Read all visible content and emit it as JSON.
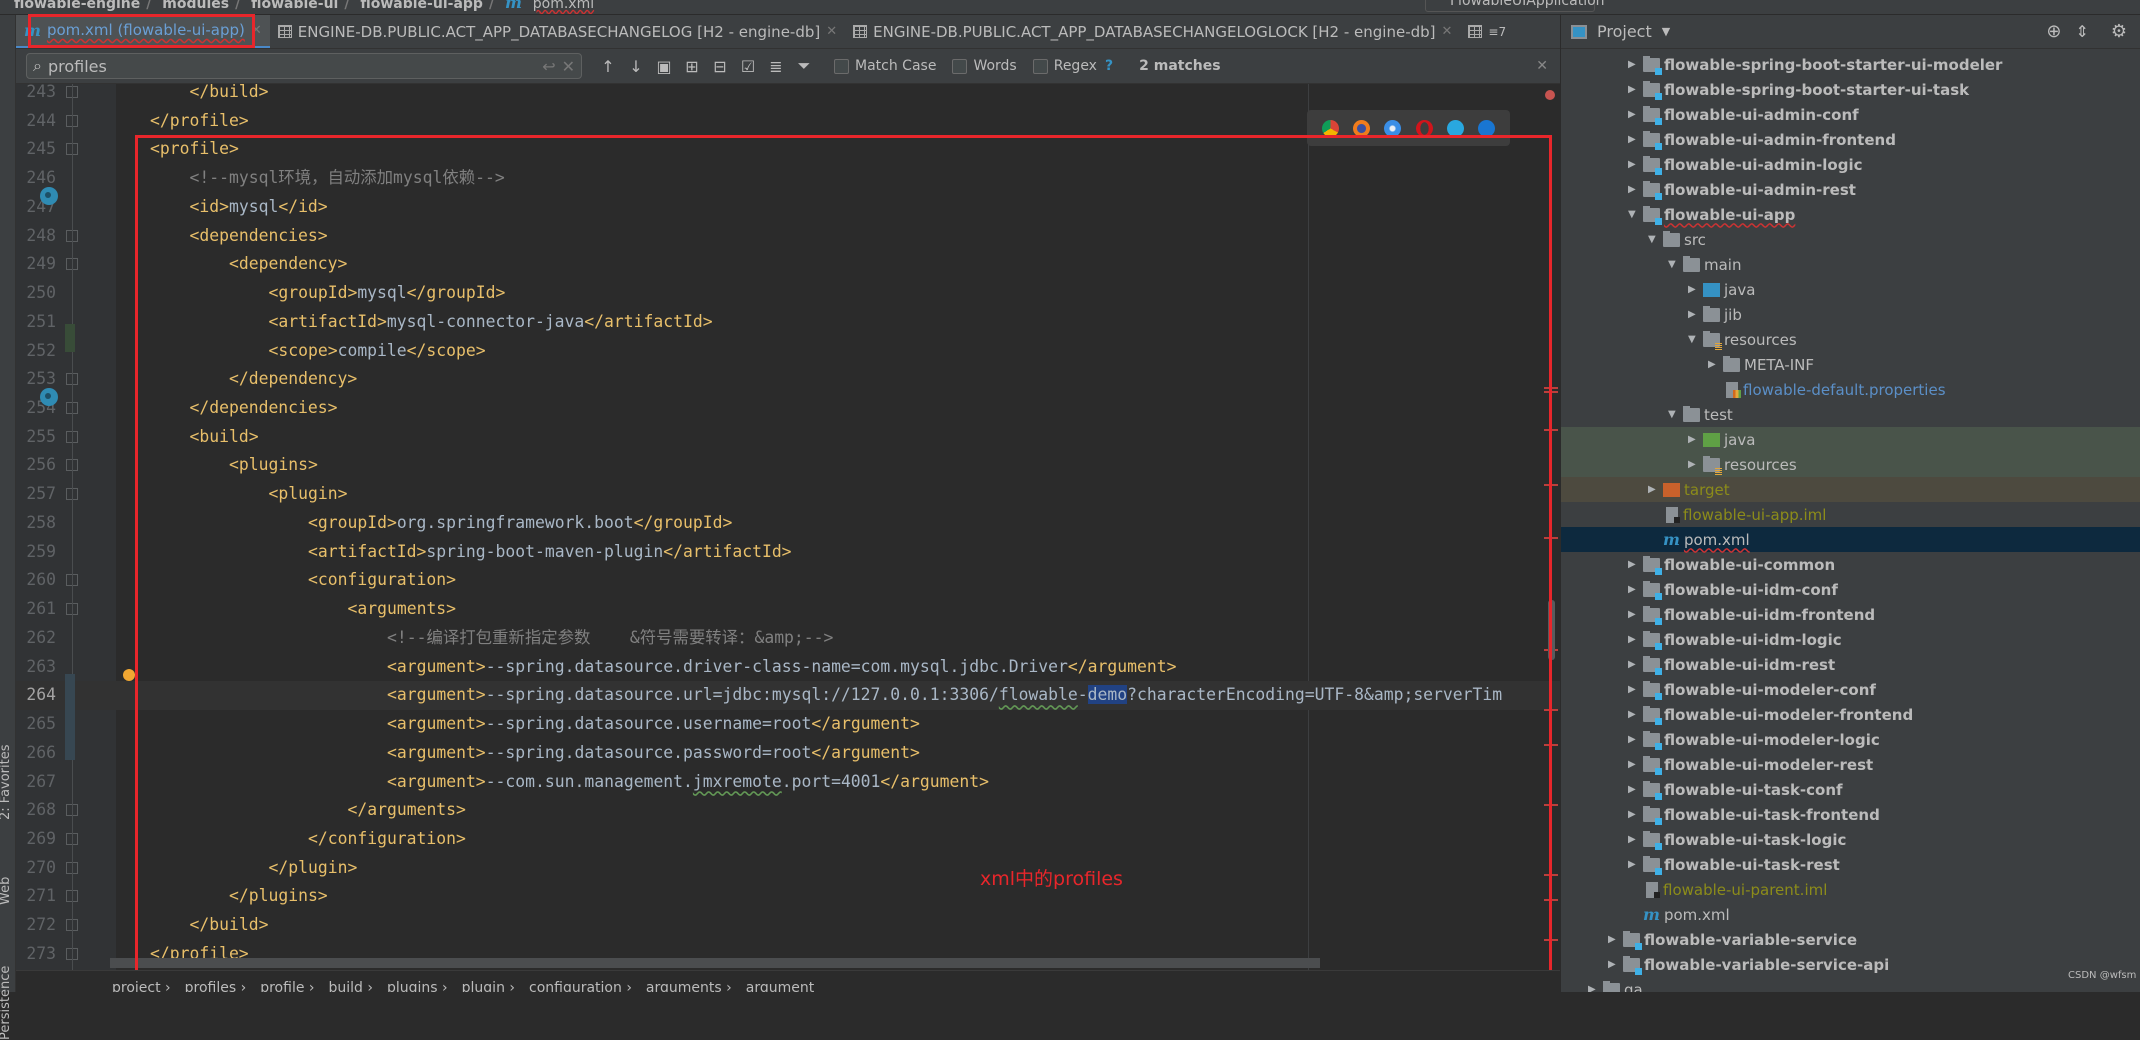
{
  "top_breadcrumb": [
    "flowable-engine",
    "modules",
    "flowable-ui",
    "flowable-ui-app",
    "pom.xml"
  ],
  "run_config": "FlowableUIApplication",
  "tabs": [
    {
      "label": "pom.xml (flowable-ui-app)",
      "icon": "maven-icon",
      "active": true
    },
    {
      "label": "ENGINE-DB.PUBLIC.ACT_APP_DATABASECHANGELOG [H2 - engine-db]",
      "icon": "table-icon"
    },
    {
      "label": "ENGINE-DB.PUBLIC.ACT_APP_DATABASECHANGELOGLOCK [H2 - engine-db]",
      "icon": "table-icon"
    }
  ],
  "tab_overflow": "≡7",
  "search": {
    "value": "profiles",
    "match_case": "Match Case",
    "words": "Words",
    "regex": "Regex",
    "help": "?",
    "matches": "2 matches"
  },
  "colors": {
    "tag": "#e8bf6a",
    "text": "#a9b7c6",
    "comment": "#808080",
    "annotation": "#e8262b",
    "selection": "#214283"
  },
  "code_lines": [
    {
      "num": "243",
      "indent": 2,
      "parts": [
        [
          "tag",
          "</build>"
        ]
      ]
    },
    {
      "num": "244",
      "indent": 1,
      "parts": [
        [
          "tag",
          "</profile>"
        ]
      ]
    },
    {
      "num": "245",
      "indent": 1,
      "parts": [
        [
          "tag",
          "<profile>"
        ]
      ]
    },
    {
      "num": "246",
      "indent": 2,
      "parts": [
        [
          "cmt",
          "<!--mysql环境，自动添加mysql依赖-->"
        ]
      ]
    },
    {
      "num": "247",
      "indent": 2,
      "parts": [
        [
          "tag",
          "<id>"
        ],
        [
          "txt",
          "mysql"
        ],
        [
          "tag",
          "</id>"
        ]
      ]
    },
    {
      "num": "248",
      "indent": 2,
      "parts": [
        [
          "tag",
          "<dependencies>"
        ]
      ]
    },
    {
      "num": "249",
      "indent": 3,
      "parts": [
        [
          "tag",
          "<dependency>"
        ]
      ]
    },
    {
      "num": "250",
      "indent": 4,
      "parts": [
        [
          "tag",
          "<groupId>"
        ],
        [
          "txt",
          "mysql"
        ],
        [
          "tag",
          "</groupId>"
        ]
      ]
    },
    {
      "num": "251",
      "indent": 4,
      "parts": [
        [
          "tag",
          "<artifactId>"
        ],
        [
          "txt",
          "mysql-connector-java"
        ],
        [
          "tag",
          "</artifactId>"
        ]
      ]
    },
    {
      "num": "252",
      "indent": 4,
      "parts": [
        [
          "tag",
          "<scope>"
        ],
        [
          "txt",
          "compile"
        ],
        [
          "tag",
          "</scope>"
        ]
      ]
    },
    {
      "num": "253",
      "indent": 3,
      "parts": [
        [
          "tag",
          "</dependency>"
        ]
      ]
    },
    {
      "num": "254",
      "indent": 2,
      "parts": [
        [
          "tag",
          "</dependencies>"
        ]
      ]
    },
    {
      "num": "255",
      "indent": 2,
      "parts": [
        [
          "tag",
          "<build>"
        ]
      ]
    },
    {
      "num": "256",
      "indent": 3,
      "parts": [
        [
          "tag",
          "<plugins>"
        ]
      ]
    },
    {
      "num": "257",
      "indent": 4,
      "parts": [
        [
          "tag",
          "<plugin>"
        ]
      ]
    },
    {
      "num": "258",
      "indent": 5,
      "parts": [
        [
          "tag",
          "<groupId>"
        ],
        [
          "txt",
          "org.springframework.boot"
        ],
        [
          "tag",
          "</groupId>"
        ]
      ]
    },
    {
      "num": "259",
      "indent": 5,
      "parts": [
        [
          "tag",
          "<artifactId>"
        ],
        [
          "txt",
          "spring-boot-maven-plugin"
        ],
        [
          "tag",
          "</artifactId>"
        ]
      ]
    },
    {
      "num": "260",
      "indent": 5,
      "parts": [
        [
          "tag",
          "<configuration>"
        ]
      ]
    },
    {
      "num": "261",
      "indent": 6,
      "parts": [
        [
          "tag",
          "<arguments>"
        ]
      ]
    },
    {
      "num": "262",
      "indent": 7,
      "parts": [
        [
          "cmt",
          "<!--编译打包重新指定参数    &符号需要转译：&amp;-->"
        ]
      ]
    },
    {
      "num": "263",
      "indent": 7,
      "parts": [
        [
          "tag",
          "<argument>"
        ],
        [
          "txt",
          "--spring.datasource.driver-class-name=com.mysql.jdbc.Driver"
        ],
        [
          "tag",
          "</argument>"
        ]
      ]
    },
    {
      "num": "264",
      "indent": 7,
      "current": true,
      "parts": [
        [
          "tag",
          "<argument>"
        ],
        [
          "txt",
          "--spring.datasource.url=jdbc:mysql://127.0.0.1:3306/"
        ],
        [
          "sq",
          "flowable"
        ],
        [
          "txt",
          "-"
        ],
        [
          "sel",
          "demo"
        ],
        [
          "txt",
          "?characterEncoding=UTF-8&amp;serverTim"
        ]
      ]
    },
    {
      "num": "265",
      "indent": 7,
      "parts": [
        [
          "tag",
          "<argument>"
        ],
        [
          "txt",
          "--spring.datasource.username=root"
        ],
        [
          "tag",
          "</argument>"
        ]
      ]
    },
    {
      "num": "266",
      "indent": 7,
      "parts": [
        [
          "tag",
          "<argument>"
        ],
        [
          "txt",
          "--spring.datasource.password=root"
        ],
        [
          "tag",
          "</argument>"
        ]
      ]
    },
    {
      "num": "267",
      "indent": 7,
      "parts": [
        [
          "tag",
          "<argument>"
        ],
        [
          "txt",
          "--com.sun.management."
        ],
        [
          "sq",
          "jmxremote"
        ],
        [
          "txt",
          ".port=4001"
        ],
        [
          "tag",
          "</argument>"
        ]
      ]
    },
    {
      "num": "268",
      "indent": 6,
      "parts": [
        [
          "tag",
          "</arguments>"
        ]
      ]
    },
    {
      "num": "269",
      "indent": 5,
      "parts": [
        [
          "tag",
          "</configuration>"
        ]
      ]
    },
    {
      "num": "270",
      "indent": 4,
      "parts": [
        [
          "tag",
          "</plugin>"
        ]
      ]
    },
    {
      "num": "271",
      "indent": 3,
      "parts": [
        [
          "tag",
          "</plugins>"
        ]
      ]
    },
    {
      "num": "272",
      "indent": 2,
      "parts": [
        [
          "tag",
          "</build>"
        ]
      ]
    },
    {
      "num": "273",
      "indent": 1,
      "parts": [
        [
          "tag",
          "</profile>"
        ]
      ]
    }
  ],
  "browser_icons": [
    "chrome-icon",
    "firefox-icon",
    "safari-icon",
    "opera-icon",
    "ie-icon",
    "edge-icon"
  ],
  "annotation": "xml中的profiles",
  "bottom_breadcrumb": [
    "project",
    "profiles",
    "profile",
    "build",
    "plugins",
    "plugin",
    "configuration",
    "arguments",
    "argument"
  ],
  "tool_strip": [
    "2: Favorites",
    "Web",
    "Persistence"
  ],
  "project_panel": {
    "title": "Project",
    "tree": [
      {
        "label": "flowable-spring-boot-starter-ui-modeler",
        "level": 2,
        "type": "module",
        "state": "closed"
      },
      {
        "label": "flowable-spring-boot-starter-ui-task",
        "level": 2,
        "type": "module",
        "state": "closed"
      },
      {
        "label": "flowable-ui-admin-conf",
        "level": 2,
        "type": "module",
        "state": "closed"
      },
      {
        "label": "flowable-ui-admin-frontend",
        "level": 2,
        "type": "module",
        "state": "closed"
      },
      {
        "label": "flowable-ui-admin-logic",
        "level": 2,
        "type": "module",
        "state": "closed"
      },
      {
        "label": "flowable-ui-admin-rest",
        "level": 2,
        "type": "module",
        "state": "closed"
      },
      {
        "label": "flowable-ui-app",
        "level": 2,
        "type": "module",
        "state": "open",
        "squiggle": true
      },
      {
        "label": "src",
        "level": 3,
        "type": "folder",
        "state": "open"
      },
      {
        "label": "main",
        "level": 4,
        "type": "folder",
        "state": "open"
      },
      {
        "label": "java",
        "level": 5,
        "type": "source",
        "state": "closed"
      },
      {
        "label": "jib",
        "level": 5,
        "type": "folder",
        "state": "closed"
      },
      {
        "label": "resources",
        "level": 5,
        "type": "resources",
        "state": "open"
      },
      {
        "label": "META-INF",
        "level": 6,
        "type": "folder",
        "state": "closed"
      },
      {
        "label": "flowable-default.properties",
        "level": 6,
        "type": "properties"
      },
      {
        "label": "test",
        "level": 4,
        "type": "folder",
        "state": "open"
      },
      {
        "label": "java",
        "level": 5,
        "type": "test-source",
        "state": "closed",
        "bg": "#49544a"
      },
      {
        "label": "resources",
        "level": 5,
        "type": "test-resources",
        "state": "closed",
        "bg": "#49544a"
      },
      {
        "label": "target",
        "level": 3,
        "type": "excluded",
        "state": "closed",
        "bg": "#4d4a3f"
      },
      {
        "label": "flowable-ui-app.iml",
        "level": 3,
        "type": "iml"
      },
      {
        "label": "pom.xml",
        "level": 3,
        "type": "maven",
        "selected": true,
        "squiggle": true
      },
      {
        "label": "flowable-ui-common",
        "level": 2,
        "type": "module",
        "state": "closed"
      },
      {
        "label": "flowable-ui-idm-conf",
        "level": 2,
        "type": "module",
        "state": "closed"
      },
      {
        "label": "flowable-ui-idm-frontend",
        "level": 2,
        "type": "module",
        "state": "closed"
      },
      {
        "label": "flowable-ui-idm-logic",
        "level": 2,
        "type": "module",
        "state": "closed"
      },
      {
        "label": "flowable-ui-idm-rest",
        "level": 2,
        "type": "module",
        "state": "closed"
      },
      {
        "label": "flowable-ui-modeler-conf",
        "level": 2,
        "type": "module",
        "state": "closed"
      },
      {
        "label": "flowable-ui-modeler-frontend",
        "level": 2,
        "type": "module",
        "state": "closed"
      },
      {
        "label": "flowable-ui-modeler-logic",
        "level": 2,
        "type": "module",
        "state": "closed"
      },
      {
        "label": "flowable-ui-modeler-rest",
        "level": 2,
        "type": "module",
        "state": "closed"
      },
      {
        "label": "flowable-ui-task-conf",
        "level": 2,
        "type": "module",
        "state": "closed"
      },
      {
        "label": "flowable-ui-task-frontend",
        "level": 2,
        "type": "module",
        "state": "closed"
      },
      {
        "label": "flowable-ui-task-logic",
        "level": 2,
        "type": "module",
        "state": "closed"
      },
      {
        "label": "flowable-ui-task-rest",
        "level": 2,
        "type": "module",
        "state": "closed"
      },
      {
        "label": "flowable-ui-parent.iml",
        "level": 2,
        "type": "iml"
      },
      {
        "label": "pom.xml",
        "level": 2,
        "type": "maven"
      },
      {
        "label": "flowable-variable-service",
        "level": 1,
        "type": "module",
        "state": "closed"
      },
      {
        "label": "flowable-variable-service-api",
        "level": 1,
        "type": "module",
        "state": "closed"
      },
      {
        "label": "qa",
        "level": 0,
        "type": "folder",
        "state": "closed"
      }
    ]
  },
  "watermark": "CSDN @wfsm"
}
